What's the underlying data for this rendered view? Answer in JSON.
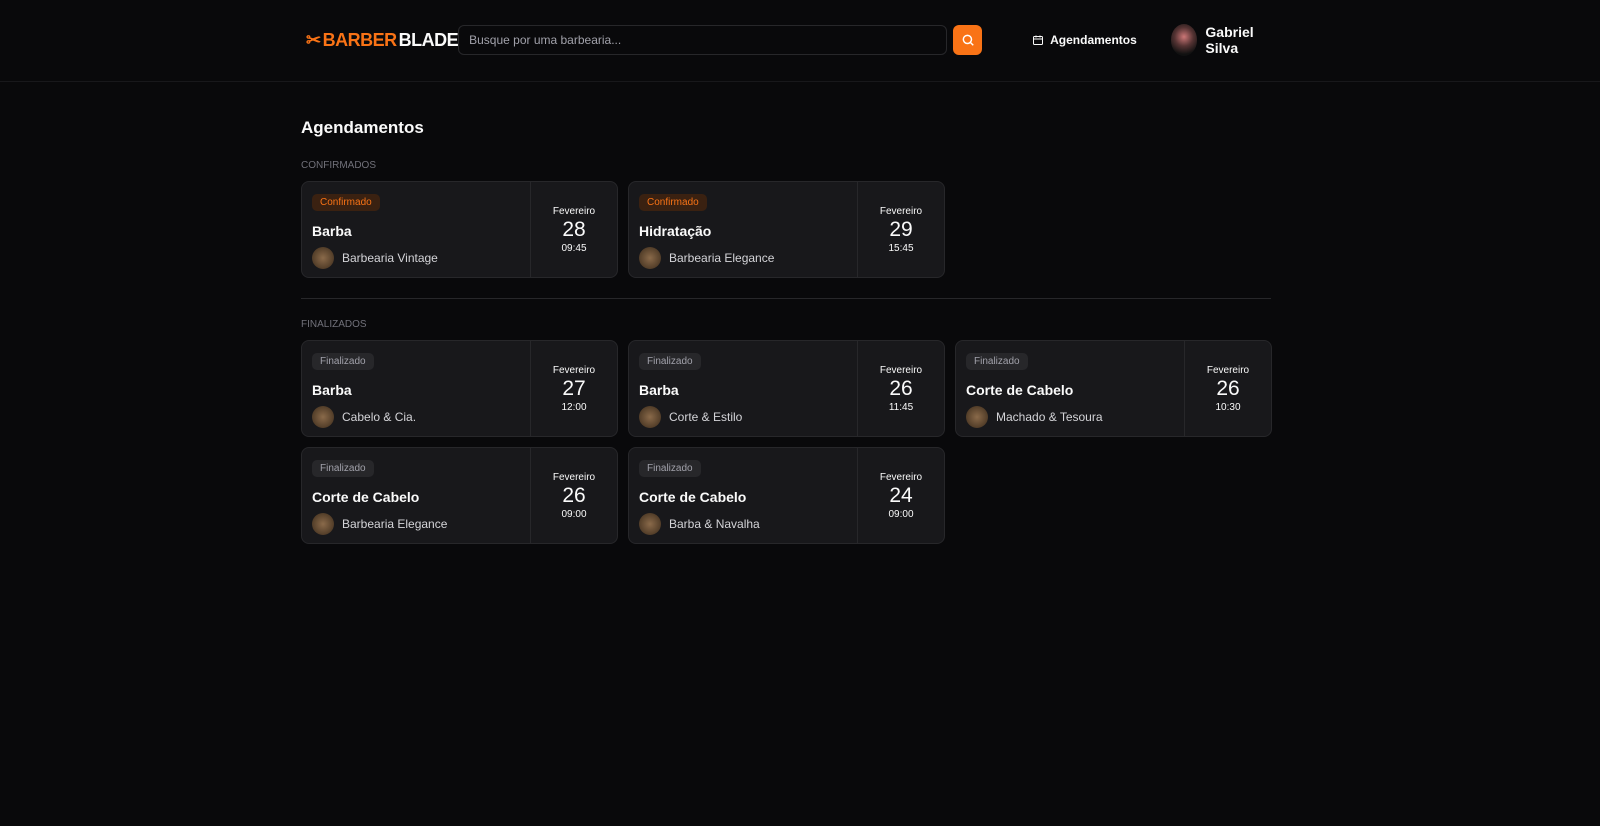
{
  "header": {
    "logo_left": "BARBER",
    "logo_right": "BLADE",
    "search_placeholder": "Busque por uma barbearia...",
    "nav_bookings": "Agendamentos",
    "user_name": "Gabriel Silva"
  },
  "page": {
    "title": "Agendamentos"
  },
  "confirmed": {
    "label": "Confirmados",
    "items": [
      {
        "status": "Confirmado",
        "service": "Barba",
        "shop": "Barbearia Vintage",
        "month": "Fevereiro",
        "day": "28",
        "time": "09:45"
      },
      {
        "status": "Confirmado",
        "service": "Hidratação",
        "shop": "Barbearia Elegance",
        "month": "Fevereiro",
        "day": "29",
        "time": "15:45"
      }
    ]
  },
  "finished": {
    "label": "Finalizados",
    "items": [
      {
        "status": "Finalizado",
        "service": "Barba",
        "shop": "Cabelo & Cia.",
        "month": "Fevereiro",
        "day": "27",
        "time": "12:00"
      },
      {
        "status": "Finalizado",
        "service": "Barba",
        "shop": "Corte & Estilo",
        "month": "Fevereiro",
        "day": "26",
        "time": "11:45"
      },
      {
        "status": "Finalizado",
        "service": "Corte de Cabelo",
        "shop": "Machado & Tesoura",
        "month": "Fevereiro",
        "day": "26",
        "time": "10:30"
      },
      {
        "status": "Finalizado",
        "service": "Corte de Cabelo",
        "shop": "Barbearia Elegance",
        "month": "Fevereiro",
        "day": "26",
        "time": "09:00"
      },
      {
        "status": "Finalizado",
        "service": "Corte de Cabelo",
        "shop": "Barba & Navalha",
        "month": "Fevereiro",
        "day": "24",
        "time": "09:00"
      }
    ]
  },
  "colors": {
    "accent": "#f97316"
  }
}
